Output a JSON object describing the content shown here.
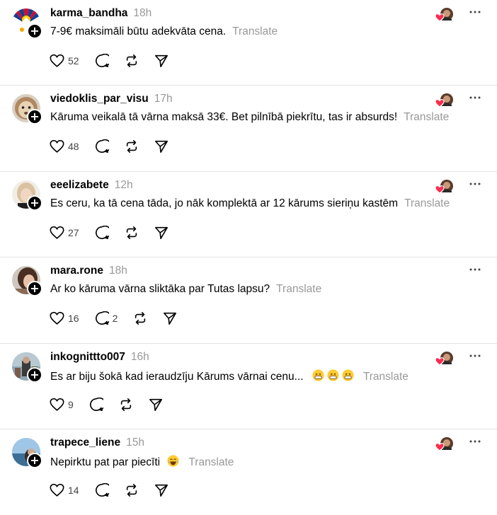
{
  "translate_label": "Translate",
  "posts": [
    {
      "username": "karma_bandha",
      "time": "18h",
      "text": "7-9€ maksimāli būtu adekvāta cena.",
      "likes": "52",
      "replies": "",
      "liked_by_author": true
    },
    {
      "username": "viedoklis_par_visu",
      "time": "17h",
      "text": "Kāruma veikalā tā vārna maksā 33€. Bet pilnībā piekrītu, tas ir absurds!",
      "likes": "48",
      "replies": "",
      "liked_by_author": true
    },
    {
      "username": "eeelizabete",
      "time": "12h",
      "text": "Es ceru, ka tā cena tāda, jo nāk komplektā ar 12 kārums sieriņu kastēm",
      "likes": "27",
      "replies": "",
      "liked_by_author": true
    },
    {
      "username": "mara.rone",
      "time": "18h",
      "text": "Ar ko kāruma vārna sliktāka par Tutas lapsu?",
      "likes": "16",
      "replies": "2",
      "liked_by_author": false
    },
    {
      "username": "inkognittto007",
      "time": "16h",
      "text": "Es ar biju šokā kad ieraudzīju Kārums vārnai cenu...",
      "emojis": [
        "grin",
        "grin",
        "grin"
      ],
      "likes": "9",
      "replies": "",
      "liked_by_author": true
    },
    {
      "username": "trapece_liene",
      "time": "15h",
      "text": "Nepirktu pat par piecīti",
      "emojis": [
        "laugh"
      ],
      "likes": "14",
      "replies": "",
      "liked_by_author": true
    }
  ],
  "colors": {
    "heart": "#ff2a4f",
    "muted": "#999999",
    "divider": "#e3e3e3"
  }
}
